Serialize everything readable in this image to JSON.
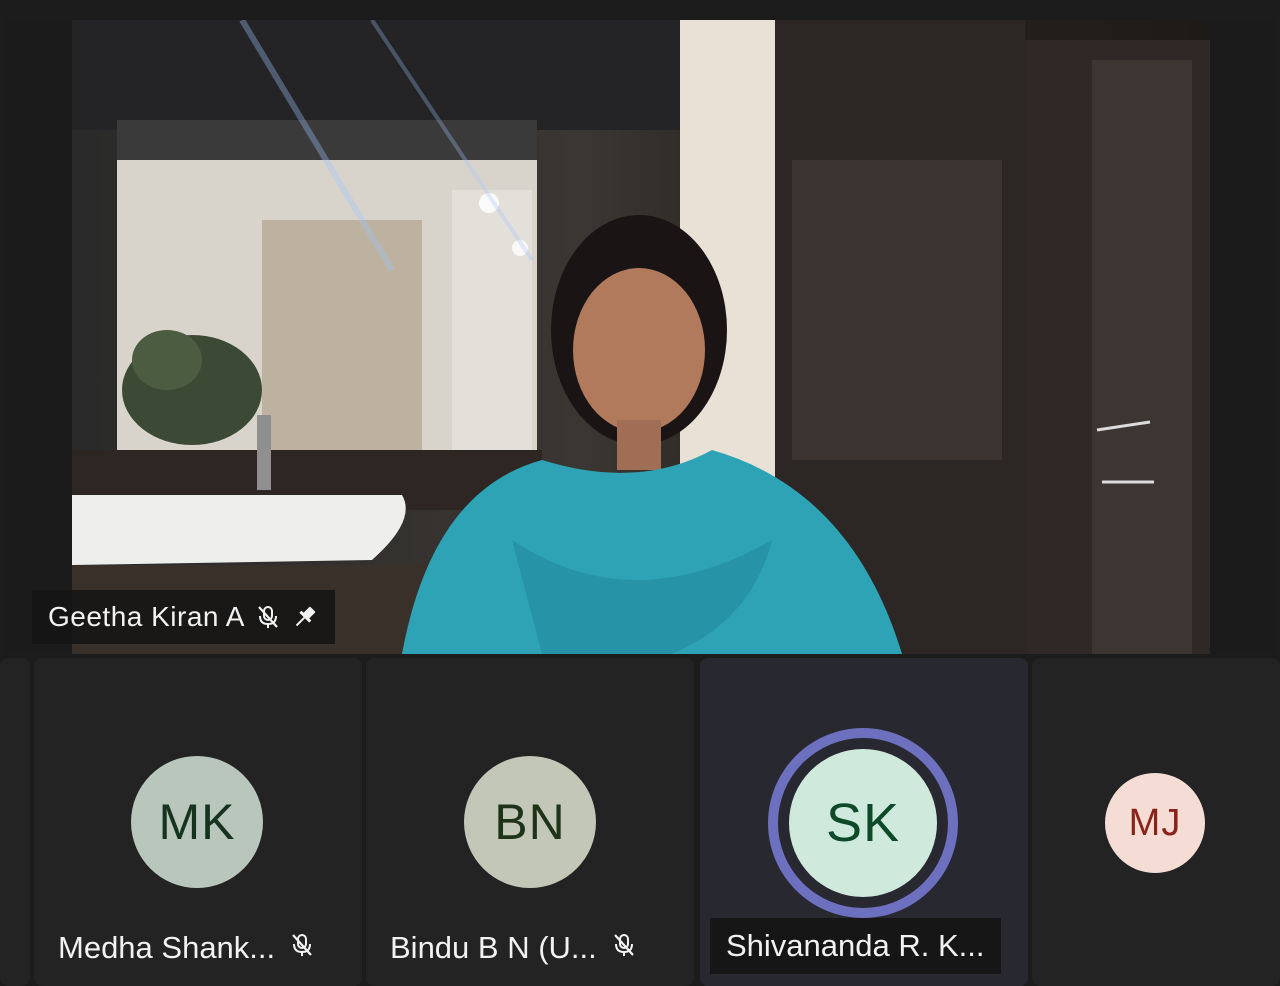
{
  "main_participant": {
    "name": "Geetha Kiran A",
    "muted": true,
    "pinned": true,
    "icons": [
      "mic-off-icon",
      "pin-icon"
    ]
  },
  "gallery": [
    {
      "initials": "MK",
      "name": "Medha Shank...",
      "muted": true,
      "avatar_color": "#b9c6bc",
      "text_color": "#16331f"
    },
    {
      "initials": "BN",
      "name": "Bindu B N (U...",
      "muted": true,
      "avatar_color": "#c3c7b8",
      "text_color": "#1f3319"
    },
    {
      "initials": "SK",
      "name": "Shivananda R. K...",
      "muted": false,
      "speaking": true,
      "avatar_color": "#cfe9dd",
      "text_color": "#0d4a2a",
      "ring_color": "#6d6fbf"
    },
    {
      "initials": "MJ",
      "name": "",
      "muted": false,
      "avatar_color": "#f5ddd6",
      "text_color": "#8a2418"
    }
  ]
}
